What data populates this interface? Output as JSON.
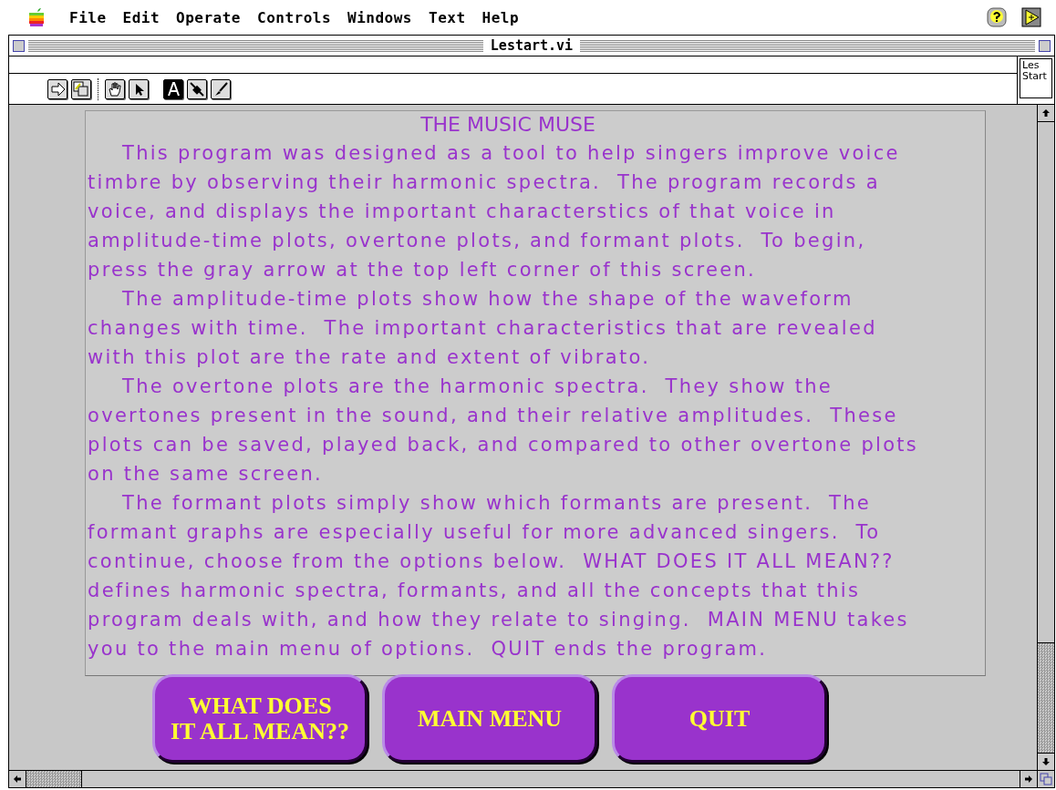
{
  "menu_bar": {
    "items": [
      "File",
      "Edit",
      "Operate",
      "Controls",
      "Windows",
      "Text",
      "Help"
    ]
  },
  "window": {
    "title": "Lestart.vi",
    "icon_label": [
      "Les",
      "Start"
    ]
  },
  "toolbar": {
    "tools": [
      {
        "kind": "run"
      },
      {
        "kind": "edit"
      },
      {
        "kind": "operate"
      },
      {
        "kind": "position"
      },
      {
        "kind": "text",
        "selected": true
      },
      {
        "kind": "wire",
        "selected": false
      },
      {
        "kind": "color",
        "selected": false
      }
    ]
  },
  "panel": {
    "heading": "THE MUSIC MUSE",
    "paragraphs": [
      [
        "This program was designed as a tool to help singers improve voice",
        "timbre by observing their harmonic spectra.  The program records a",
        "voice, and displays the important characterstics of that voice in",
        "amplitude-time plots, overtone plots, and formant plots.  To begin,",
        "press the gray arrow at the top left corner of this screen."
      ],
      [
        "The amplitude-time plots show how the shape of the waveform",
        "changes with time.  The important characteristics that are revealed",
        "with this plot are the rate and extent of vibrato."
      ],
      [
        "The overtone plots are the harmonic spectra.  They show the",
        "overtones present in the sound, and their relative amplitudes.  These",
        "plots can be saved, played back, and compared to other overtone plots",
        "on the same screen."
      ],
      [
        "The formant plots simply show which formants are present.  The",
        "formant graphs are especially useful for more advanced singers.  To",
        "continue, choose from the options below.  WHAT DOES IT ALL MEAN??",
        "defines harmonic spectra, formants, and all the concepts that this",
        "program deals with, and how they relate to singing.  MAIN MENU takes",
        "you to the main menu of options.  QUIT ends the program."
      ]
    ]
  },
  "buttons": [
    [
      "WHAT DOES",
      "IT ALL MEAN??"
    ],
    [
      "MAIN MENU"
    ],
    [
      "QUIT"
    ]
  ]
}
